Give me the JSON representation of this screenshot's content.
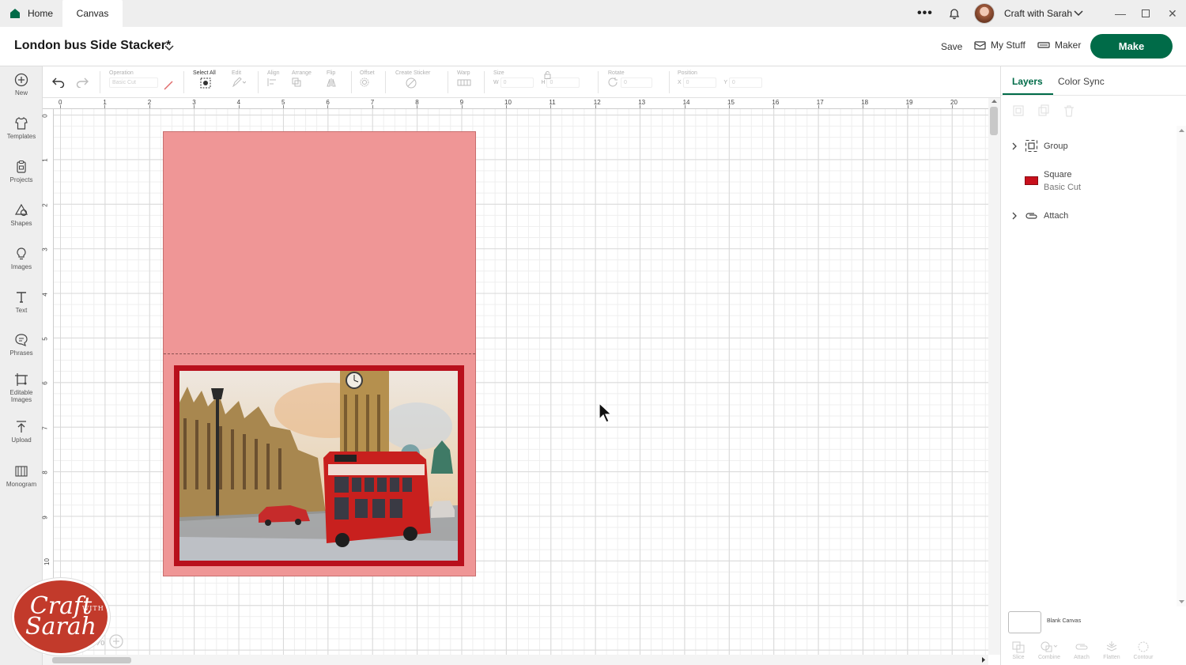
{
  "tabs": {
    "home": "Home",
    "canvas": "Canvas"
  },
  "topbar": {
    "more": "•••",
    "user_name": "Craft with Sarah"
  },
  "header": {
    "project_title": "London bus Side Stacker*",
    "save": "Save",
    "my_stuff": "My Stuff",
    "maker": "Maker",
    "make": "Make"
  },
  "sidebar": {
    "items": [
      {
        "label": "New",
        "icon": "plus-circle-icon"
      },
      {
        "label": "Templates",
        "icon": "shirt-icon"
      },
      {
        "label": "Projects",
        "icon": "clipboard-icon"
      },
      {
        "label": "Shapes",
        "icon": "shapes-icon"
      },
      {
        "label": "Images",
        "icon": "bulb-icon"
      },
      {
        "label": "Text",
        "icon": "text-icon"
      },
      {
        "label": "Phrases",
        "icon": "speech-icon"
      },
      {
        "label": "Editable",
        "label2": "Images",
        "icon": "edit-image-icon"
      },
      {
        "label": "Upload",
        "icon": "upload-icon"
      },
      {
        "label": "Monogram",
        "icon": "monogram-icon"
      }
    ]
  },
  "toolbar": {
    "operation_label": "Operation",
    "operation_value": "Basic Cut",
    "select_all": "Select All",
    "edit": "Edit",
    "align": "Align",
    "arrange": "Arrange",
    "flip": "Flip",
    "offset": "Offset",
    "create_sticker": "Create Sticker",
    "warp": "Warp",
    "size": "Size",
    "w": "W",
    "h": "H",
    "rotate": "Rotate",
    "position": "Position",
    "x": "X",
    "y": "Y",
    "zero": "0"
  },
  "ruler": {
    "top": [
      "0",
      "1",
      "2",
      "3",
      "4",
      "5",
      "6",
      "7",
      "8",
      "9",
      "10",
      "11",
      "12",
      "13",
      "14",
      "15",
      "16",
      "17",
      "18",
      "19",
      "20"
    ],
    "left": [
      "0",
      "1",
      "2",
      "3",
      "4",
      "5",
      "6",
      "7",
      "8",
      "9",
      "10"
    ]
  },
  "canvas": {
    "card_color": "#ef9696",
    "mat_color": "#b8101c",
    "image": "london-bus-big-ben-watercolor"
  },
  "zoom": {
    "value": "%"
  },
  "brand": {
    "line1": "Craft",
    "with": "WITH",
    "line2": "Sarah"
  },
  "layers_panel": {
    "tab_layers": "Layers",
    "tab_color_sync": "Color Sync",
    "layers": [
      {
        "name": "Group",
        "icon": "group-icon"
      },
      {
        "name": "Square",
        "sub": "Basic Cut",
        "color": "#c8101c"
      },
      {
        "name": "Attach",
        "icon": "attach-icon"
      }
    ],
    "blank_canvas": "Blank Canvas",
    "bottom_tools": [
      "Slice",
      "Combine",
      "Attach",
      "Flatten",
      "Contour"
    ]
  },
  "colors": {
    "accent": "#006b48"
  }
}
